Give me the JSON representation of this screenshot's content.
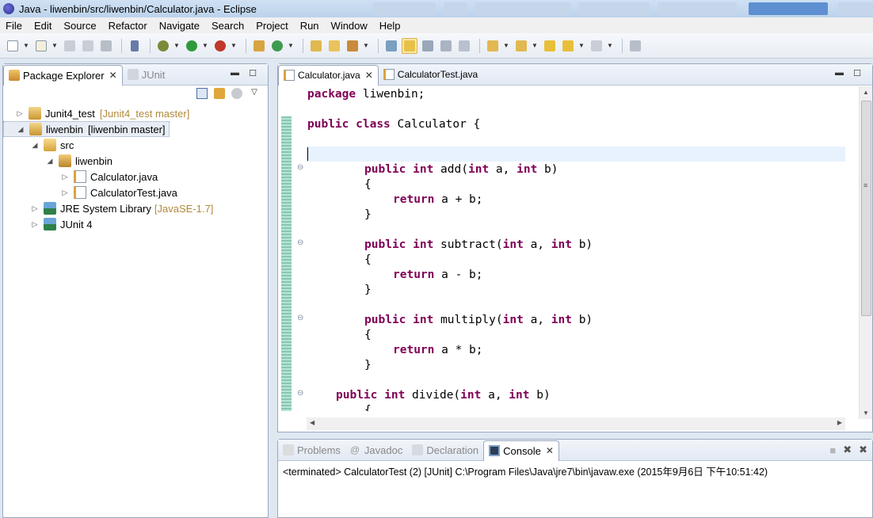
{
  "window": {
    "title": "Java - liwenbin/src/liwenbin/Calculator.java - Eclipse"
  },
  "menu": [
    "File",
    "Edit",
    "Source",
    "Refactor",
    "Navigate",
    "Search",
    "Project",
    "Run",
    "Window",
    "Help"
  ],
  "package_explorer": {
    "tabs": [
      {
        "label": "Package Explorer",
        "active": true
      },
      {
        "label": "JUnit",
        "active": false
      }
    ],
    "tree": [
      {
        "label": "Junit4_test",
        "decoration": "[Junit4_test master]",
        "depth": 0,
        "expanded": false,
        "icon": "project-icon"
      },
      {
        "label": "liwenbin",
        "decoration": "[liwenbin master]",
        "depth": 0,
        "expanded": true,
        "icon": "project-icon",
        "selected": true
      },
      {
        "label": "src",
        "decoration": "",
        "depth": 1,
        "expanded": true,
        "icon": "source-folder-icon"
      },
      {
        "label": "liwenbin",
        "decoration": "",
        "depth": 2,
        "expanded": true,
        "icon": "package-icon"
      },
      {
        "label": "Calculator.java",
        "decoration": "",
        "depth": 3,
        "expanded": false,
        "icon": "java-file-icon"
      },
      {
        "label": "CalculatorTest.java",
        "decoration": "",
        "depth": 3,
        "expanded": false,
        "icon": "java-file-icon"
      },
      {
        "label": "JRE System Library",
        "decoration": "[JavaSE-1.7]",
        "depth": 1,
        "expanded": false,
        "icon": "library-icon"
      },
      {
        "label": "JUnit 4",
        "decoration": "",
        "depth": 1,
        "expanded": false,
        "icon": "library-icon"
      }
    ]
  },
  "editor": {
    "tabs": [
      {
        "label": "Calculator.java",
        "active": true
      },
      {
        "label": "CalculatorTest.java",
        "active": false
      }
    ],
    "lines": [
      "package liwenbin;",
      "public class Calculator {",
      "public int add(int a, int b)",
      "{",
      "return a + b;",
      "}",
      "public int subtract(int a, int b)",
      "{",
      "return a - b;",
      "}",
      "public int multiply(int a, int b)",
      "{",
      "return a * b;",
      "}",
      "public int divide(int a, int b)",
      "{"
    ]
  },
  "bottom_panel": {
    "tabs": [
      {
        "label": "Problems",
        "active": false
      },
      {
        "label": "Javadoc",
        "active": false
      },
      {
        "label": "Declaration",
        "active": false
      },
      {
        "label": "Console",
        "active": true
      }
    ],
    "console_text": "<terminated> CalculatorTest (2) [JUnit] C:\\Program Files\\Java\\jre7\\bin\\javaw.exe (2015年9月6日 下午10:51:42)"
  },
  "colors": {
    "keyword": "#7f0055",
    "current_line": "#e8f2fe",
    "tree_decoration": "#b08a3c"
  }
}
